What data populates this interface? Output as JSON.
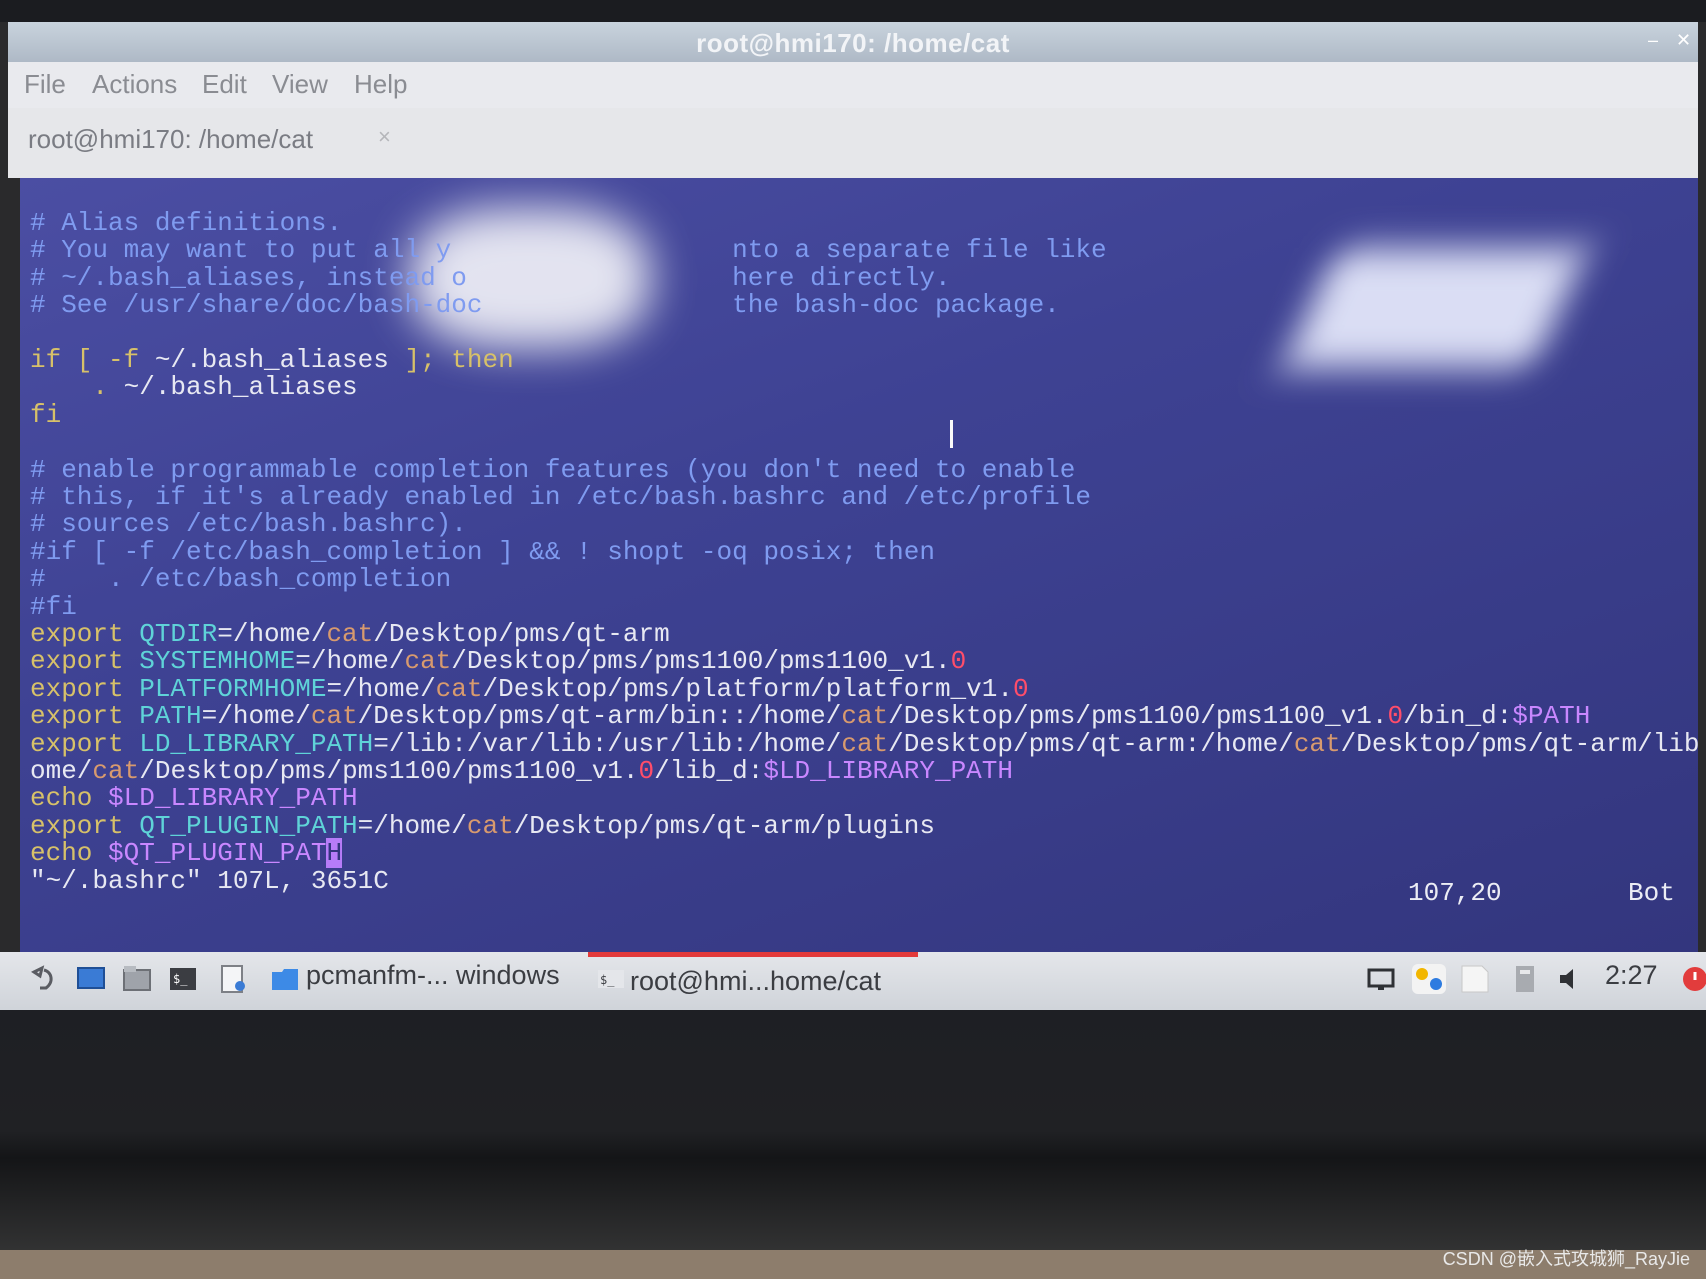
{
  "window": {
    "title": "root@hmi170: /home/cat"
  },
  "menu": {
    "items": [
      "File",
      "Actions",
      "Edit",
      "View",
      "Help"
    ]
  },
  "tab": {
    "label": "root@hmi170: /home/cat",
    "close": "×"
  },
  "terminal": {
    "lines": [
      [
        {
          "t": "# Alias definitions.",
          "c": "comment"
        }
      ],
      [
        {
          "t": "# You may want to put all y",
          "c": "comment"
        },
        {
          "t": "                  ",
          "c": ""
        },
        {
          "t": "nto a separate file like",
          "c": "comment"
        }
      ],
      [
        {
          "t": "# ~/.bash_aliases, instead o",
          "c": "comment"
        },
        {
          "t": "                 ",
          "c": ""
        },
        {
          "t": "here directly.",
          "c": "comment"
        }
      ],
      [
        {
          "t": "# See /usr/share/doc/bash-doc",
          "c": "comment"
        },
        {
          "t": "                ",
          "c": ""
        },
        {
          "t": "the bash-doc package.",
          "c": "comment"
        }
      ],
      [
        {
          "t": "",
          "c": ""
        }
      ],
      [
        {
          "t": "if [ -f ",
          "c": "kw"
        },
        {
          "t": "~/.bash_aliases",
          "c": ""
        },
        {
          "t": " ]; then",
          "c": "kw"
        }
      ],
      [
        {
          "t": "    . ",
          "c": "kw"
        },
        {
          "t": "~/.bash_aliases",
          "c": ""
        }
      ],
      [
        {
          "t": "fi",
          "c": "kw"
        }
      ],
      [
        {
          "t": "",
          "c": ""
        }
      ],
      [
        {
          "t": "# enable programmable completion features (you don't need to enable",
          "c": "comment"
        }
      ],
      [
        {
          "t": "# this, if it's already enabled in /etc/bash.bashrc and /etc/profile",
          "c": "comment"
        }
      ],
      [
        {
          "t": "# sources /etc/bash.bashrc).",
          "c": "comment"
        }
      ],
      [
        {
          "t": "#if [ -f /etc/bash_completion ] && ! shopt -oq posix; then",
          "c": "comment"
        }
      ],
      [
        {
          "t": "#    . /etc/bash_completion",
          "c": "comment"
        }
      ],
      [
        {
          "t": "#fi",
          "c": "comment"
        }
      ],
      [
        {
          "t": "export ",
          "c": "kw"
        },
        {
          "t": "QTDIR",
          "c": "var"
        },
        {
          "t": "=/home/",
          "c": ""
        },
        {
          "t": "cat",
          "c": "str"
        },
        {
          "t": "/Desktop/pms/qt-arm",
          "c": ""
        }
      ],
      [
        {
          "t": "export ",
          "c": "kw"
        },
        {
          "t": "SYSTEMHOME",
          "c": "var"
        },
        {
          "t": "=/home/",
          "c": ""
        },
        {
          "t": "cat",
          "c": "str"
        },
        {
          "t": "/Desktop/pms/pms1100/pms1100_v1.",
          "c": ""
        },
        {
          "t": "0",
          "c": "num"
        }
      ],
      [
        {
          "t": "export ",
          "c": "kw"
        },
        {
          "t": "PLATFORMHOME",
          "c": "var"
        },
        {
          "t": "=/home/",
          "c": ""
        },
        {
          "t": "cat",
          "c": "str"
        },
        {
          "t": "/Desktop/pms/platform/platform_v1.",
          "c": ""
        },
        {
          "t": "0",
          "c": "num"
        }
      ],
      [
        {
          "t": "export ",
          "c": "kw"
        },
        {
          "t": "PATH",
          "c": "var"
        },
        {
          "t": "=/home/",
          "c": ""
        },
        {
          "t": "cat",
          "c": "str"
        },
        {
          "t": "/Desktop/pms/qt-arm/bin::/home/",
          "c": ""
        },
        {
          "t": "cat",
          "c": "str"
        },
        {
          "t": "/Desktop/pms/pms1100/pms1100_v1.",
          "c": ""
        },
        {
          "t": "0",
          "c": "num"
        },
        {
          "t": "/bin_d:",
          "c": ""
        },
        {
          "t": "$PATH",
          "c": "env"
        }
      ],
      [
        {
          "t": "export ",
          "c": "kw"
        },
        {
          "t": "LD_LIBRARY_PATH",
          "c": "var"
        },
        {
          "t": "=/lib:/var/lib:/usr/lib:/home/",
          "c": ""
        },
        {
          "t": "cat",
          "c": "str"
        },
        {
          "t": "/Desktop/pms/qt-arm:/home/",
          "c": ""
        },
        {
          "t": "cat",
          "c": "str"
        },
        {
          "t": "/Desktop/pms/qt-arm/lib:/h",
          "c": ""
        }
      ],
      [
        {
          "t": "ome/",
          "c": ""
        },
        {
          "t": "cat",
          "c": "str"
        },
        {
          "t": "/Desktop/pms/pms1100/pms1100_v1.",
          "c": ""
        },
        {
          "t": "0",
          "c": "num"
        },
        {
          "t": "/lib_d:",
          "c": ""
        },
        {
          "t": "$LD_LIBRARY_PATH",
          "c": "env"
        }
      ],
      [
        {
          "t": "echo ",
          "c": "kw"
        },
        {
          "t": "$LD_LIBRARY_PATH",
          "c": "env"
        }
      ],
      [
        {
          "t": "export ",
          "c": "kw"
        },
        {
          "t": "QT_PLUGIN_PATH",
          "c": "var"
        },
        {
          "t": "=/home/",
          "c": ""
        },
        {
          "t": "cat",
          "c": "str"
        },
        {
          "t": "/Desktop/pms/qt-arm/plugins",
          "c": ""
        }
      ],
      [
        {
          "t": "echo ",
          "c": "kw"
        },
        {
          "t": "$QT_PLUGIN_PAT",
          "c": "env"
        },
        {
          "t": "H",
          "c": "cursor"
        }
      ],
      [
        {
          "t": "\"~/.bashrc\" 107L, 3651C",
          "c": ""
        }
      ]
    ],
    "status_position": "107,20",
    "status_scroll": "Bot"
  },
  "taskbar": {
    "tasks": [
      {
        "label": "pcmanfm-... windows"
      },
      {
        "label": "root@hmi...home/cat"
      }
    ],
    "clock": "2:27"
  },
  "watermark": "CSDN @嵌入式攻城狮_RayJie",
  "colors": {
    "terminal_bg": "#3e4293",
    "comment": "#7f9bf0",
    "keyword": "#d7c169",
    "variable": "#5fd3d8",
    "number": "#ff4d6a",
    "env": "#c987ff",
    "active_task": "#e33a3a"
  }
}
